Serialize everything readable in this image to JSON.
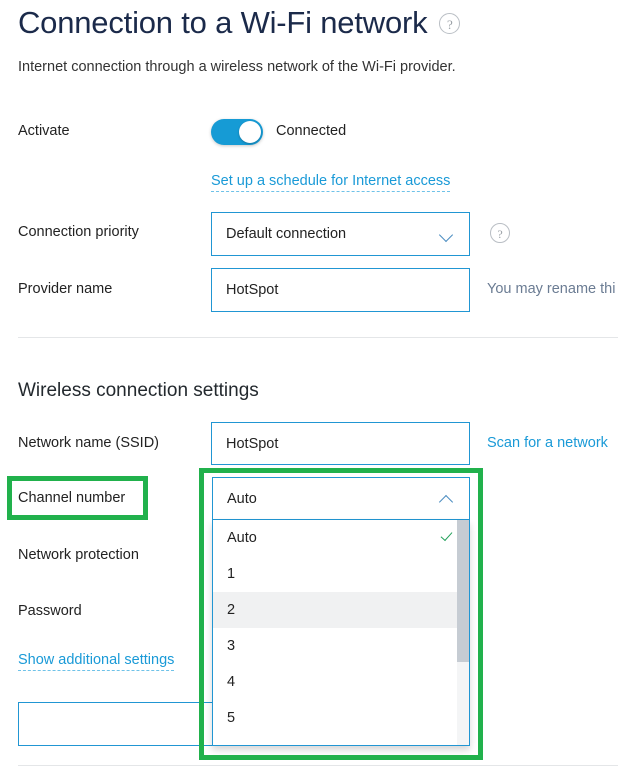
{
  "page": {
    "title": "Connection to a Wi-Fi network",
    "title_help_icon": "question-mark-circle-icon",
    "subtitle": "Internet connection through a wireless network of the Wi-Fi provider."
  },
  "activate": {
    "label": "Activate",
    "toggle_state": "on",
    "status_text": "Connected",
    "schedule_link": "Set up a schedule for Internet access"
  },
  "connection_priority": {
    "label": "Connection priority",
    "value": "Default connection",
    "chevron_icon": "chevron-down-icon",
    "help_icon": "question-mark-circle-icon"
  },
  "provider_name": {
    "label": "Provider name",
    "value": "HotSpot",
    "hint": "You may rename thi"
  },
  "wireless_section": {
    "title": "Wireless connection settings",
    "ssid": {
      "label": "Network name (SSID)",
      "value": "HotSpot",
      "scan_link": "Scan for a network"
    },
    "channel": {
      "label": "Channel number",
      "value": "Auto",
      "chevron_icon": "chevron-up-icon",
      "expanded": true,
      "options": [
        {
          "label": "Auto",
          "selected": true,
          "hovered": false
        },
        {
          "label": "1",
          "selected": false,
          "hovered": false
        },
        {
          "label": "2",
          "selected": false,
          "hovered": true
        },
        {
          "label": "3",
          "selected": false,
          "hovered": false
        },
        {
          "label": "4",
          "selected": false,
          "hovered": false
        },
        {
          "label": "5",
          "selected": false,
          "hovered": false
        }
      ],
      "check_icon": "checkmark-icon"
    },
    "network_protection": {
      "label": "Network protection"
    },
    "password": {
      "label": "Password"
    },
    "show_additional": "Show additional settings"
  },
  "colors": {
    "accent_blue": "#1a9ad7",
    "field_border": "#2196d3",
    "title_navy": "#1b2a4a",
    "highlight_green": "#21b14c",
    "check_green": "#22a05a",
    "hint_grey": "#6b7c93"
  }
}
